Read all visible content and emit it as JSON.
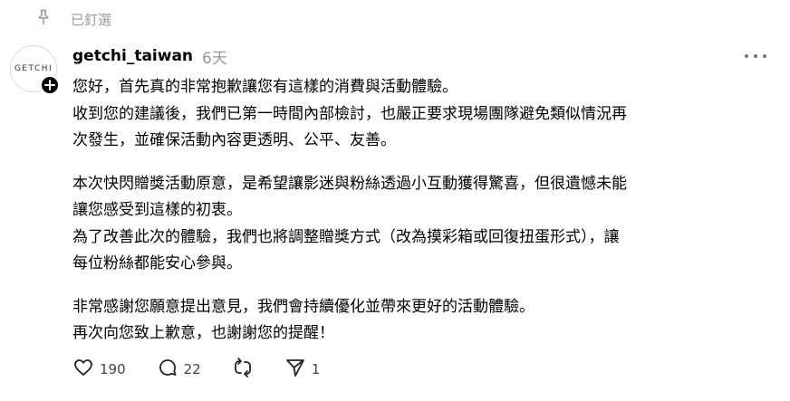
{
  "pinned": {
    "label": "已釘選",
    "icon": "pin-icon"
  },
  "avatar": {
    "text": "GETCHI",
    "badge_icon": "plus-icon"
  },
  "post": {
    "username": "getchi_taiwan",
    "time_ago": "6天",
    "more_icon": "more-icon",
    "lines": [
      "您好，首先真的非常抱歉讓您有這樣的消費與活動體驗。",
      "收到您的建議後，我們已第一時間內部檢討，也嚴正要求現場團隊避免類似情況再",
      "次發生，並確保活動內容更透明、公平、友善。",
      "本次快閃贈獎活動原意，是希望讓影迷與粉絲透過小互動獲得驚喜，但很遺憾未能",
      "讓您感受到這樣的初衷。",
      "為了改善此次的體驗，我們也將調整贈獎方式（改為摸彩箱或回復扭蛋形式），讓",
      "每位粉絲都能安心參與。",
      "非常感謝您願意提出意見，我們會持續優化並帶來更好的活動體驗。",
      "再次向您致上歉意，也謝謝您的提醒！"
    ]
  },
  "actions": {
    "like": {
      "icon": "heart-icon",
      "count": "190"
    },
    "comment": {
      "icon": "comment-icon",
      "count": "22"
    },
    "repost": {
      "icon": "repost-icon"
    },
    "share": {
      "icon": "send-icon",
      "count": "1"
    }
  }
}
